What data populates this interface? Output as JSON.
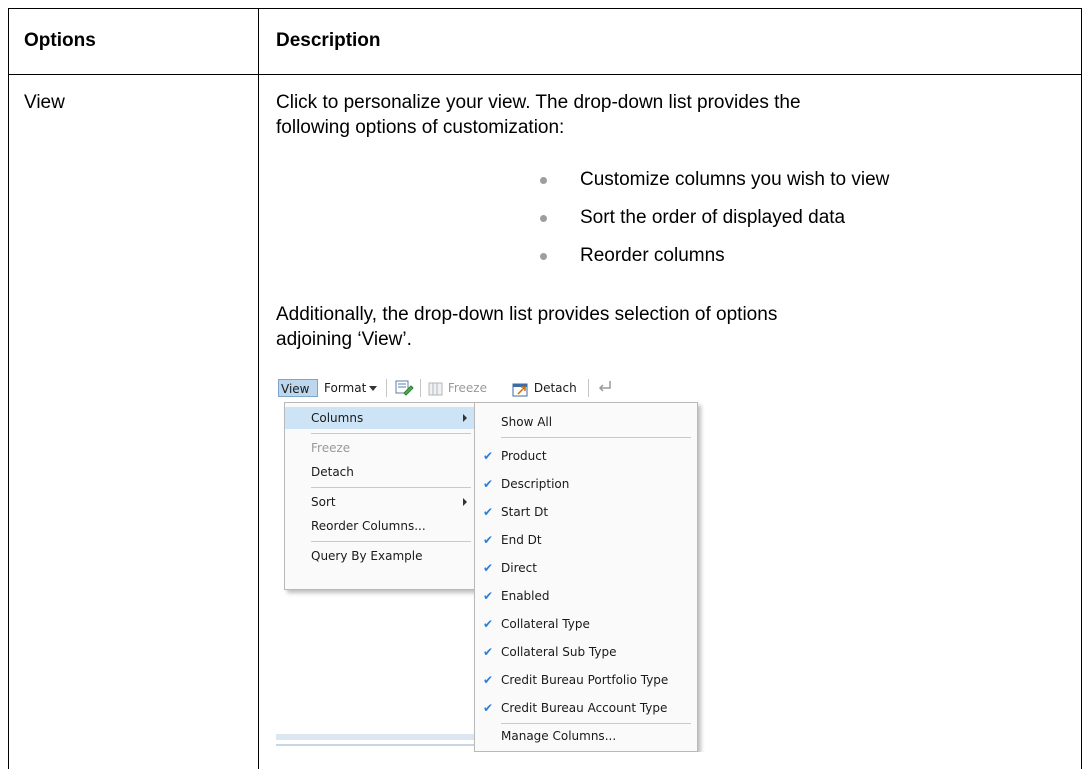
{
  "table": {
    "headers": {
      "options": "Options",
      "description": "Description"
    },
    "row": {
      "option": "View",
      "desc_line1": "Click to personalize your view. The drop-down list provides the",
      "desc_line2": "following options of customization:",
      "bullets": [
        "Customize columns you wish to view",
        "Sort the order of displayed data",
        "Reorder columns"
      ],
      "add_line1": "Additionally, the drop-down list provides selection of options",
      "add_line2": "adjoining ‘View’."
    }
  },
  "screenshot": {
    "toolbar": {
      "view": "View",
      "format": "Format",
      "freeze": "Freeze",
      "detach": "Detach"
    },
    "view_menu": {
      "columns": "Columns",
      "freeze": "Freeze",
      "detach": "Detach",
      "sort": "Sort",
      "reorder": "Reorder Columns...",
      "query": "Query By Example"
    },
    "columns_menu": {
      "show_all": "Show All",
      "items": [
        "Product",
        "Description",
        "Start Dt",
        "End Dt",
        "Direct",
        "Enabled",
        "Collateral Type",
        "Collateral Sub Type",
        "Credit Bureau Portfolio Type",
        "Credit Bureau Account Type"
      ],
      "manage": "Manage Columns..."
    },
    "colors": {
      "highlight": "#cde4f7",
      "check": "#2d7fd3",
      "view_button": "#bcd6ee"
    }
  }
}
